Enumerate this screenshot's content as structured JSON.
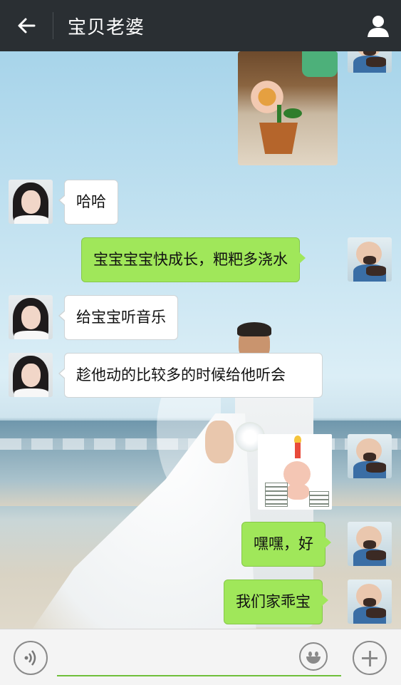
{
  "header": {
    "title": "宝贝老婆",
    "back_icon": "arrow-left-icon",
    "profile_icon": "person-icon"
  },
  "messages": [
    {
      "side": "right",
      "type": "image",
      "sender": "baby-avatar",
      "content": "flower-pot-photo"
    },
    {
      "side": "left",
      "type": "text",
      "sender": "girl-avatar",
      "text": "哈哈"
    },
    {
      "side": "right",
      "type": "text",
      "sender": "baby-avatar",
      "text": "宝宝宝宝快成长，粑粑多浇水"
    },
    {
      "side": "left",
      "type": "text",
      "sender": "girl-avatar",
      "text": "给宝宝听音乐"
    },
    {
      "side": "left",
      "type": "text",
      "sender": "girl-avatar",
      "text": "趁他动的比较多的时候给他听会"
    },
    {
      "side": "right",
      "type": "sticker",
      "sender": "baby-avatar",
      "content": "baby-birthday-candle-sticker"
    },
    {
      "side": "right",
      "type": "text",
      "sender": "baby-avatar",
      "text": "嘿嘿，好"
    },
    {
      "side": "right",
      "type": "text",
      "sender": "baby-avatar",
      "text": "我们家乖宝"
    }
  ],
  "input_bar": {
    "value": "",
    "voice_icon": "voice-icon",
    "emoji_icon": "emoji-icon",
    "plus_icon": "plus-icon"
  },
  "colors": {
    "header_bg": "#2a2f33",
    "sent_bubble": "#a0e75a",
    "received_bubble": "#ffffff",
    "input_underline": "#6fbf3a"
  }
}
